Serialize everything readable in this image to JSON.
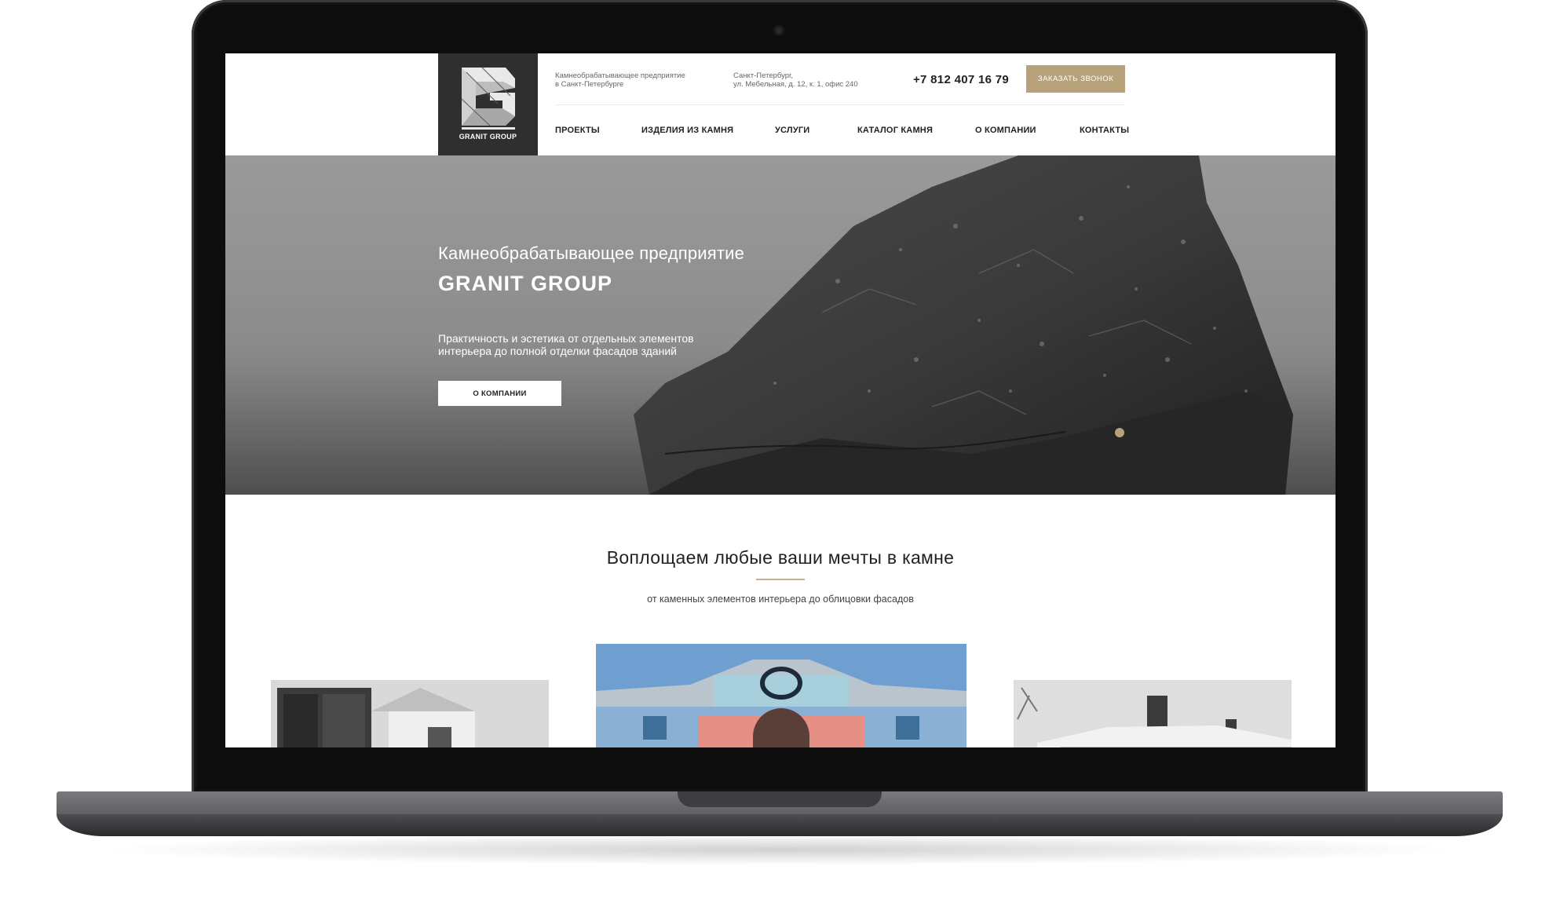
{
  "header": {
    "logo_text": "GRANIT GROUP",
    "tagline_line1": "Камнеобрабатывающее предприятие",
    "tagline_line2": "в Санкт-Петербурге",
    "address_line1": "Санкт-Петербург,",
    "address_line2": "ул. Мебельная, д. 12, к. 1, офис 240",
    "phone": "+7 812 407 16 79",
    "callback_label": "ЗАКАЗАТЬ ЗВОНОК"
  },
  "nav": {
    "items": [
      {
        "label": "ПРОЕКТЫ"
      },
      {
        "label": "ИЗДЕЛИЯ ИЗ КАМНЯ"
      },
      {
        "label": "УСЛУГИ"
      },
      {
        "label": "КАТАЛОГ КАМНЯ"
      },
      {
        "label": "О КОМПАНИИ"
      },
      {
        "label": "КОНТАКТЫ"
      }
    ]
  },
  "hero": {
    "subtitle": "Камнеобрабатывающее предприятие",
    "title": "GRANIT GROUP",
    "desc_line1": "Практичность и эстетика от отдельных элементов",
    "desc_line2": "интерьера до полной отделки фасадов зданий",
    "button_label": "О КОМПАНИИ"
  },
  "section": {
    "title": "Воплощаем любые ваши мечты в камне",
    "subtitle": "от каменных элементов интерьера до облицовки фасадов"
  },
  "colors": {
    "accent": "#b8a27c",
    "logo_bg": "#2f2f2f",
    "laptop_bezel": "#0d0d0d"
  }
}
